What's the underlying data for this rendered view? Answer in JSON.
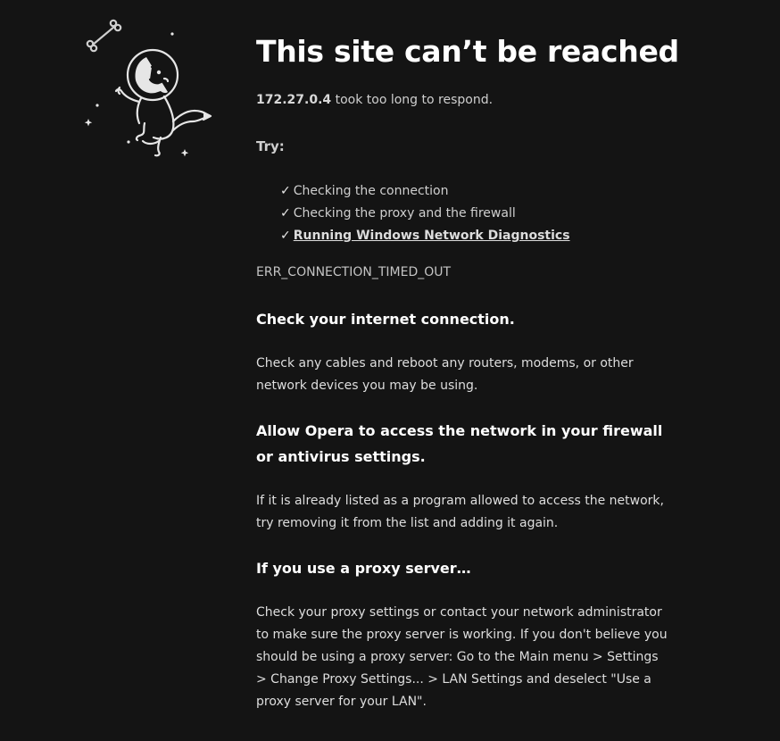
{
  "main": {
    "title": "This site can’t be reached",
    "host": "172.27.0.4",
    "subtitle_rest": " took too long to respond.",
    "try_label": "Try:",
    "try_items": [
      "Checking the connection",
      "Checking the proxy and the firewall",
      "Running Windows Network Diagnostics"
    ],
    "check_mark": "✓",
    "error_code": "ERR_CONNECTION_TIMED_OUT"
  },
  "details": {
    "internet_heading": "Check your internet connection.",
    "internet_text": "Check any cables and reboot any routers, modems, or other network devices you may be using.",
    "firewall_heading": "Allow Opera to access the network in your firewall or antivirus settings.",
    "firewall_text": "If it is already listed as a program allowed to access the network, try removing it from the list and adding it again.",
    "proxy_heading": "If you use a proxy server…",
    "proxy_text": "Check your proxy settings or contact your network administrator to make sure the proxy server is working. If you don't believe you should be using a proxy server: Go to the Main menu > Settings > Change Proxy Settings... > LAN Settings and deselect \"Use a proxy server for your LAN\"."
  },
  "colors": {
    "background": "#141414",
    "text": "#e6e6e6",
    "heading": "#ffffff"
  },
  "icons": {
    "illustration": "space-dog-astronaut-icon",
    "bone": "bone-icon",
    "star": "star-icon"
  }
}
